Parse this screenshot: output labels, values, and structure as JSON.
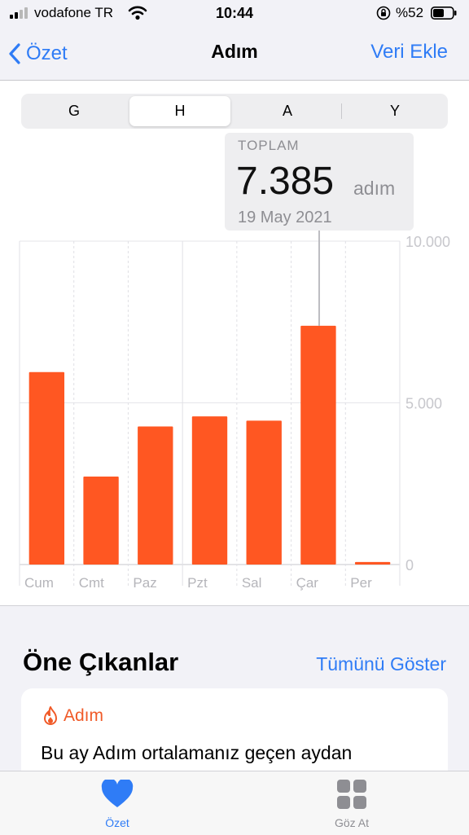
{
  "status_bar": {
    "carrier": "vodafone TR",
    "time": "10:44",
    "battery": "%52"
  },
  "nav": {
    "back_label": "Özet",
    "title": "Adım",
    "action_label": "Veri Ekle"
  },
  "segments": {
    "items": [
      "G",
      "H",
      "A",
      "Y"
    ],
    "selected": "H"
  },
  "callout": {
    "label": "TOPLAM",
    "value": "7.385",
    "unit": "adım",
    "date": "19 May 2021"
  },
  "chart_data": {
    "type": "bar",
    "categories": [
      "Cum",
      "Cmt",
      "Paz",
      "Pzt",
      "Sal",
      "Çar",
      "Per"
    ],
    "values": [
      5950,
      2720,
      4270,
      4580,
      4450,
      7385,
      80
    ],
    "ylim": [
      0,
      10000
    ],
    "yticks": [
      0,
      5000,
      10000
    ],
    "ytick_labels": [
      "0",
      "5.000",
      "10.000"
    ],
    "bar_color": "#ff5722",
    "grid": true
  },
  "highlights": {
    "title": "Öne Çıkanlar",
    "show_all": "Tümünü Göster",
    "card": {
      "tag": "Adım",
      "text": "Bu ay Adım ortalamanız geçen aydan"
    }
  },
  "tab_bar": {
    "items": [
      {
        "label": "Özet",
        "icon": "heart-icon",
        "active": true
      },
      {
        "label": "Göz At",
        "icon": "grid-icon",
        "active": false
      }
    ]
  },
  "colors": {
    "accent": "#2f7cf6",
    "bar": "#ff5722",
    "tag": "#f05a28"
  }
}
